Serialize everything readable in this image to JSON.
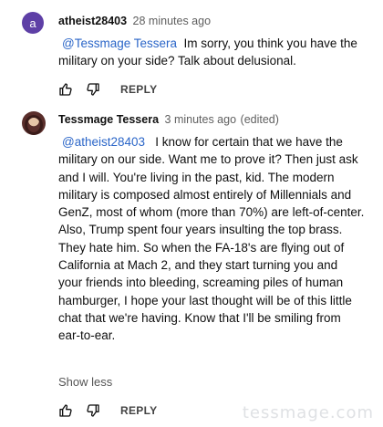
{
  "comments": [
    {
      "avatar_letter": "a",
      "author": "atheist28403",
      "time": "28 minutes ago",
      "edited": "",
      "mention": "@Tessmage Tessera",
      "text": "Im sorry, you think you have the military on your side? Talk about delusional.",
      "reply_label": "REPLY"
    },
    {
      "author": "Tessmage Tessera",
      "time": "3 minutes ago",
      "edited": "(edited)",
      "mention": "@atheist28403",
      "text": "I know for certain that we have the military on our side. Want me to prove it? Then just ask and I will. You're living in the past, kid. The modern military is composed almost entirely of Millennials and GenZ, most of whom (more than 70%) are left-of-center. Also, Trump spent four years insulting the top brass. They hate him. So when the FA-18's are flying out of California at Mach 2, and they start turning you and your friends into bleeding, screaming piles of human hamburger, I hope your last thought will be of this little chat that we're having. Know that I'll be smiling from ear-to-ear.",
      "show_less_label": "Show less",
      "reply_label": "REPLY"
    }
  ],
  "watermark": "tessmage.com"
}
